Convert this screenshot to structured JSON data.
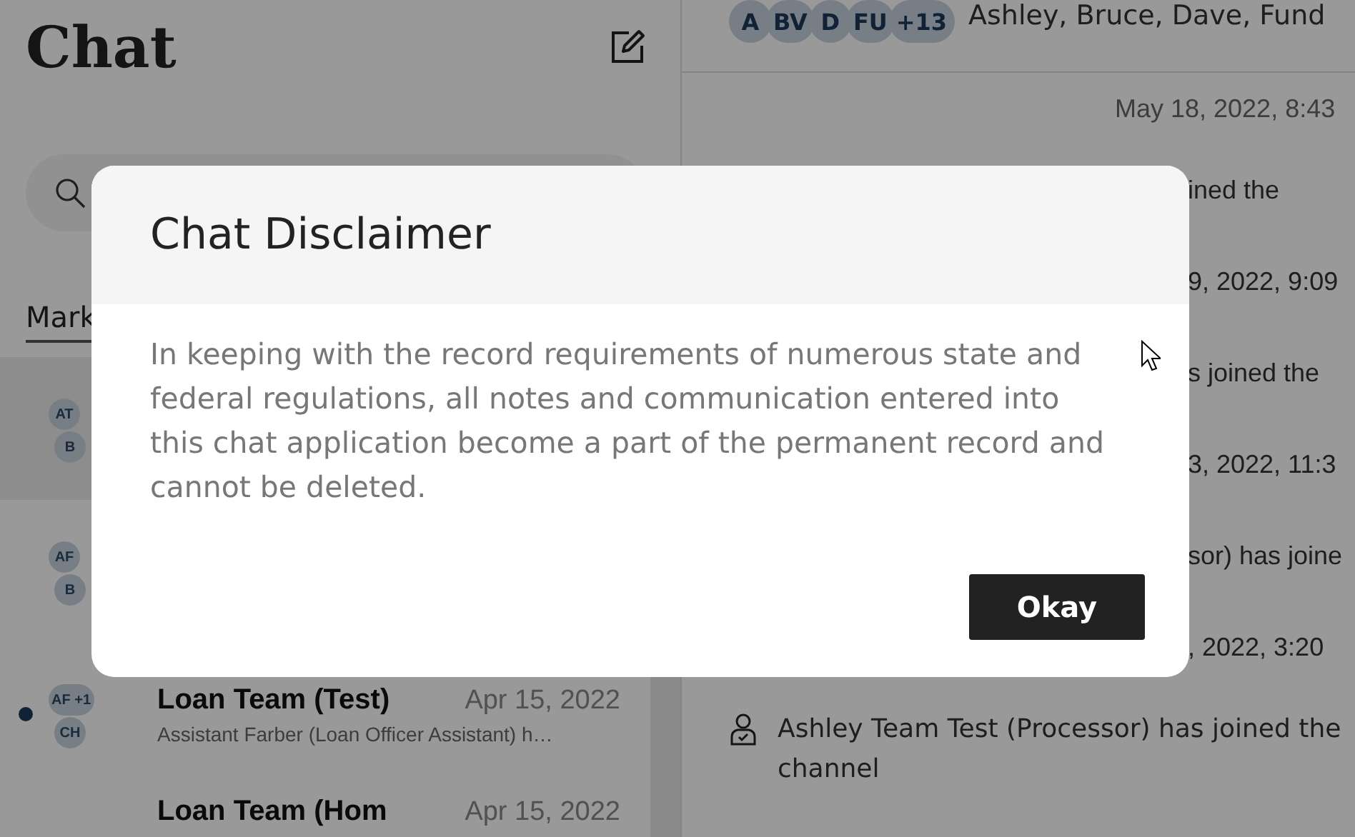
{
  "sidebar": {
    "title": "Chat",
    "tabs": [
      {
        "label": "Mark",
        "selected": true
      }
    ],
    "conversations": [
      {
        "avatars": [
          "AT",
          "B"
        ],
        "selected": true,
        "unread": false
      },
      {
        "avatars": [
          "AF",
          "B"
        ],
        "selected": false,
        "unread": false
      },
      {
        "avatars": [
          "AF +1",
          "CH"
        ],
        "selected": false,
        "unread": true,
        "name": "Loan Team (Test)",
        "date": "Apr 15, 2022",
        "preview": "Assistant Farber (Loan Officer Assistant) h…"
      },
      {
        "selected": false,
        "unread": false,
        "name": "Loan Team (Hom",
        "date": "Apr 15, 2022"
      }
    ]
  },
  "conversation": {
    "avatars": [
      "A",
      "BV",
      "D",
      "FU",
      "+13"
    ],
    "participants": "Ashley, Bruce, Dave, Fund",
    "events": [
      {
        "kind": "timestamp",
        "text": "May 18, 2022, 8:43"
      },
      {
        "kind": "fragment",
        "text": "ined the"
      },
      {
        "kind": "fragment",
        "text": "9, 2022, 9:09"
      },
      {
        "kind": "fragment",
        "text": "s joined the"
      },
      {
        "kind": "fragment",
        "text": "3, 2022, 11:3"
      },
      {
        "kind": "fragment",
        "text": "sor) has joine"
      },
      {
        "kind": "fragment",
        "text": ", 2022, 3:20"
      },
      {
        "kind": "system",
        "text": "Ashley Team Test (Processor) has joined the channel"
      }
    ]
  },
  "dialog": {
    "title": "Chat Disclaimer",
    "body": "In keeping with the record requirements of numerous state and federal regulations, all notes and communication entered into this chat application become a part of the permanent record and cannot be deleted.",
    "button": "Okay"
  }
}
